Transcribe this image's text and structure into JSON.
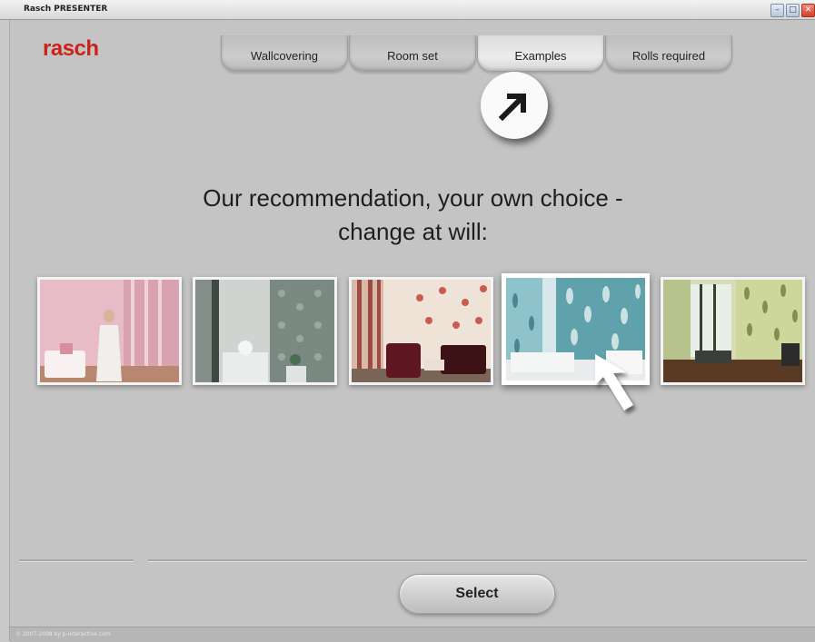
{
  "window": {
    "title": "Rasch PRESENTER",
    "minimize_glyph": "–",
    "maximize_glyph": "□",
    "close_glyph": "✕"
  },
  "brand": {
    "logo_text": "rasch",
    "color": "#c9241b"
  },
  "tabs": [
    {
      "label": "Wallcovering",
      "active": false
    },
    {
      "label": "Room set",
      "active": false
    },
    {
      "label": "Examples",
      "active": true
    },
    {
      "label": "Rolls required",
      "active": false
    }
  ],
  "hint": {
    "icon": "arrow-up-right-icon"
  },
  "headline": {
    "line1": "Our recommendation, your own choice -",
    "line2": "change at will:"
  },
  "examples": [
    {
      "name": "pink-room",
      "colors": [
        "#e5b7c3",
        "#c98b9b",
        "#f4f0f0"
      ]
    },
    {
      "name": "grey-pattern-room",
      "colors": [
        "#a9b1ad",
        "#6e7a73",
        "#e9ecea"
      ]
    },
    {
      "name": "red-floral-room",
      "colors": [
        "#c9897a",
        "#6a1e22",
        "#f1e6dc"
      ]
    },
    {
      "name": "turquoise-leaf-room",
      "colors": [
        "#8fc3cc",
        "#2f7a87",
        "#e6eef0"
      ],
      "selected": true
    },
    {
      "name": "green-leaf-room",
      "colors": [
        "#b6c48a",
        "#5b6c32",
        "#4a3320"
      ]
    }
  ],
  "cursor": {
    "icon": "mouse-pointer-icon"
  },
  "select_button": {
    "label": "Select"
  },
  "footer": {
    "copyright": "© 2007-2008 by p-interactive.com"
  }
}
